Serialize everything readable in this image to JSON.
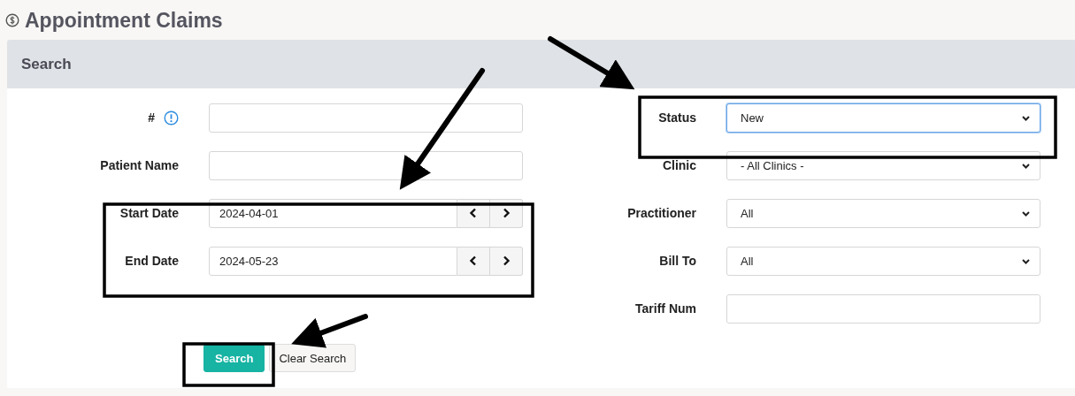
{
  "page": {
    "title": "Appointment Claims"
  },
  "search_panel": {
    "title": "Search",
    "left_fields": [
      {
        "kind": "text",
        "label": "#",
        "has_info": true,
        "highlighted": false
      },
      {
        "kind": "text",
        "label": "Patient Name",
        "has_info": false,
        "highlighted": false
      },
      {
        "kind": "date",
        "label": "Start Date",
        "value": "2024-04-01",
        "has_info": false,
        "highlighted": true
      },
      {
        "kind": "date",
        "label": "End Date",
        "value": "2024-05-23",
        "has_info": false,
        "highlighted": true
      }
    ],
    "right_fields": [
      {
        "kind": "select",
        "label": "Status",
        "value": "New",
        "focused": true,
        "highlighted": true
      },
      {
        "kind": "select",
        "label": "Clinic",
        "value": "- All Clinics -",
        "focused": false,
        "highlighted": false
      },
      {
        "kind": "select",
        "label": "Practitioner",
        "value": "All",
        "focused": false,
        "highlighted": false
      },
      {
        "kind": "select",
        "label": "Bill To",
        "value": "All",
        "focused": false,
        "highlighted": false
      },
      {
        "kind": "text",
        "label": "Tariff Num",
        "focused": false,
        "highlighted": false
      }
    ],
    "buttons": [
      {
        "kind": "primary",
        "label": "Search",
        "highlighted": true
      },
      {
        "kind": "default",
        "label": "Clear Search",
        "highlighted": false
      }
    ]
  }
}
